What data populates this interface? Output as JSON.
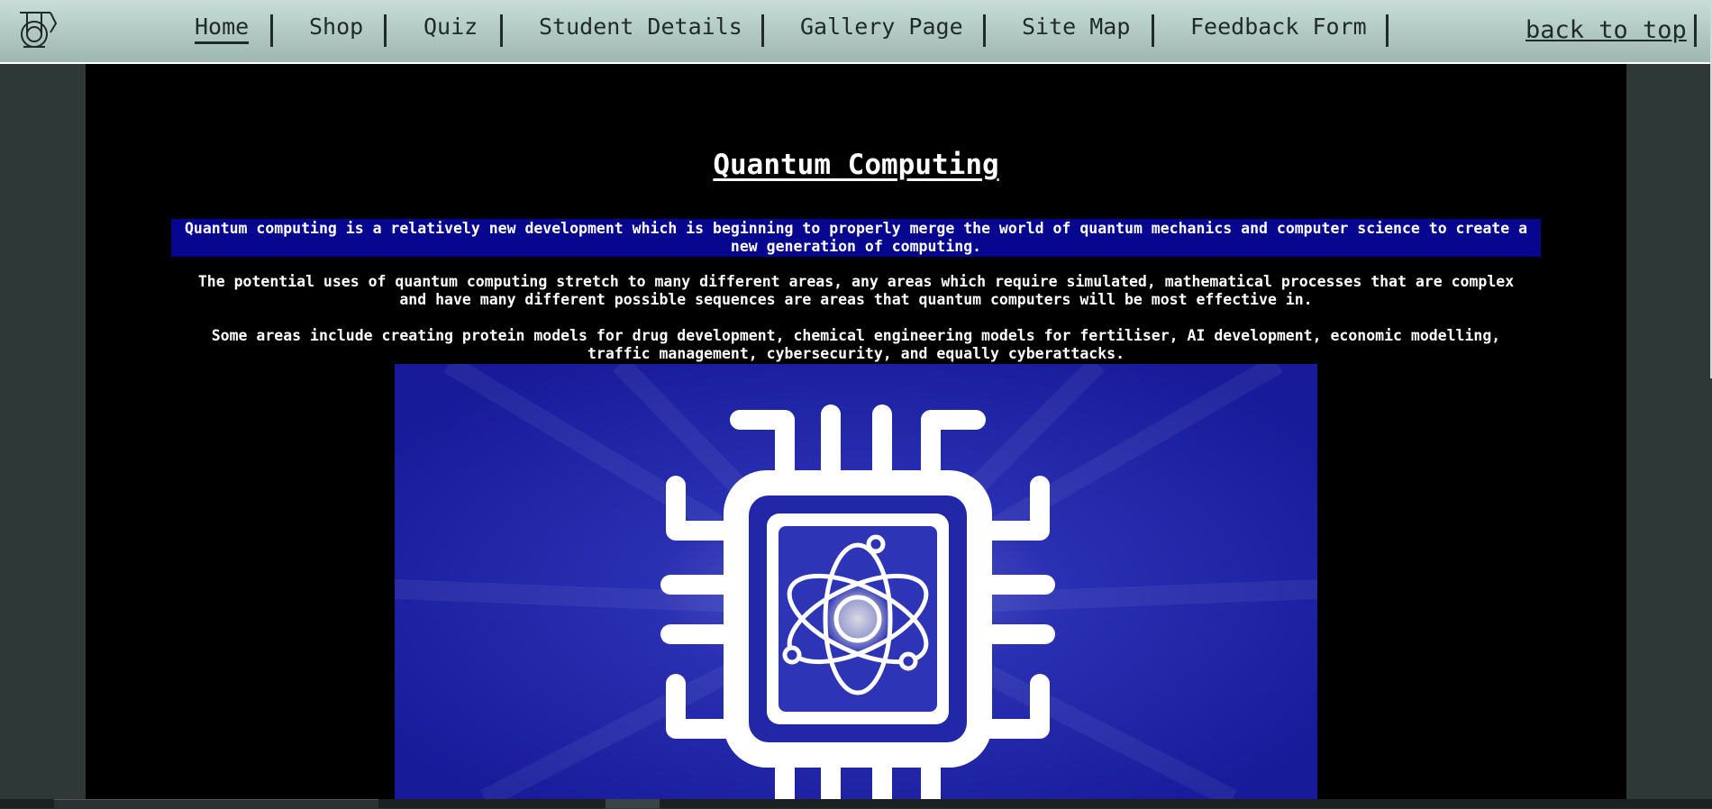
{
  "nav": {
    "items": [
      {
        "label": "Home",
        "active": true
      },
      {
        "label": "Shop"
      },
      {
        "label": "Quiz"
      },
      {
        "label": "Student Details"
      },
      {
        "label": "Gallery Page"
      },
      {
        "label": "Site Map"
      },
      {
        "label": "Feedback Form"
      }
    ],
    "back_to_top": "back to top"
  },
  "main": {
    "title": "Quantum Computing",
    "paragraphs": [
      "Quantum computing is a relatively new development which is beginning to properly merge the world of quantum mechanics and computer science to create a new generation of computing.",
      "The potential uses of quantum computing stretch to many different areas, any areas which require simulated, mathematical processes that are complex and have many different possible sequences are areas that quantum computers will be most effective in.",
      "Some areas include creating protein models for drug development, chemical engineering models for fertiliser, AI development, economic modelling, traffic management, cybersecurity, and equally cyberattacks."
    ],
    "image_icon": "quantum-chip-icon"
  },
  "colors": {
    "navbar": "#b4cbc5",
    "page_bg": "#2e3836",
    "content_bg": "#000000",
    "highlight": "#06068f",
    "image_blue": "#1a1fa6"
  }
}
